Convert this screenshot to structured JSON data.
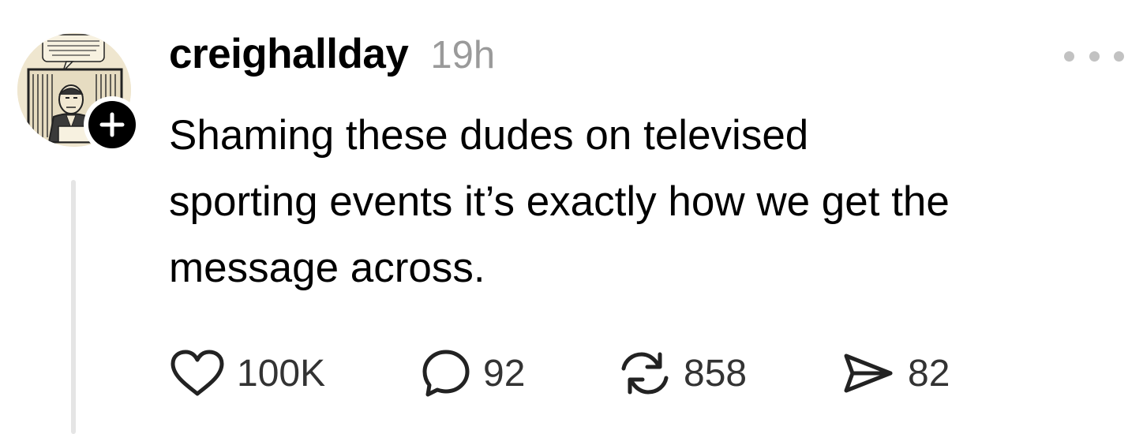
{
  "post": {
    "username": "creighallday",
    "timestamp": "19h",
    "text_lines": [
      "Shaming these dudes on televised",
      "sporting events it’s exactly how we get the",
      "message across."
    ]
  },
  "avatar": {
    "speech_bubble_text": "IN THE NEWS FROM THE WORLD SITUATION LOOKS PRETTY BAD, FOLKS ..."
  },
  "actions": {
    "like_count": "100K",
    "reply_count": "92",
    "repost_count": "858",
    "share_count": "82"
  },
  "icons": {
    "like": "heart-icon",
    "reply": "speech-bubble-icon",
    "repost": "repost-arrows-icon",
    "share": "paper-plane-icon",
    "more": "more-dots-icon",
    "follow": "plus-icon"
  },
  "colors": {
    "text": "#000000",
    "muted": "#9a9a9a",
    "thread_line": "#e5e5e5",
    "count_text": "#333333"
  }
}
